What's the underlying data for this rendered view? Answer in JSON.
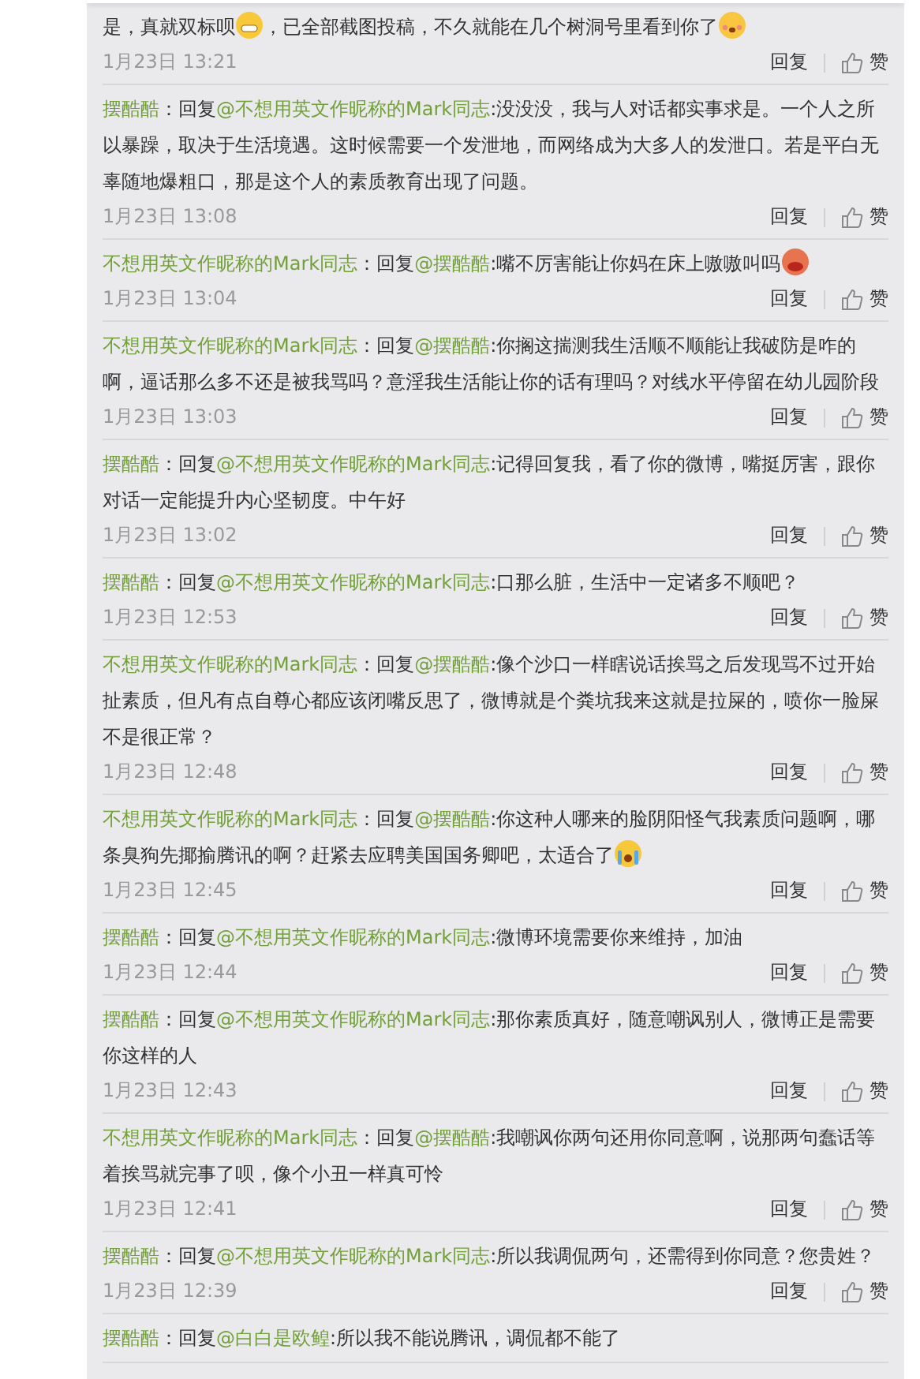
{
  "comments": [
    {
      "parts": [
        {
          "kind": "plain",
          "text": "是，真就双标呗"
        },
        {
          "kind": "grin"
        },
        {
          "kind": "plain",
          "text": "，已全部截图投稿，不久就能在几个树洞号里看到你了"
        },
        {
          "kind": "blush"
        }
      ],
      "time": "1月23日 13:21",
      "reply_label": "回复",
      "like_label": "赞"
    },
    {
      "parts": [
        {
          "kind": "author",
          "text": "摆酷酷"
        },
        {
          "kind": "plain",
          "text": "：回复"
        },
        {
          "kind": "mention",
          "text": "@不想用英文作昵称的Mark同志"
        },
        {
          "kind": "plain",
          "text": ":没没没，我与人对话都实事求是。一个人之所以暴躁，取决于生活境遇。这时候需要一个发泄地，而网络成为大多人的发泄口。若是平白无辜随地爆粗口，那是这个人的素质教育出现了问题。"
        }
      ],
      "time": "1月23日 13:08",
      "reply_label": "回复",
      "like_label": "赞"
    },
    {
      "parts": [
        {
          "kind": "author",
          "text": "不想用英文作昵称的Mark同志"
        },
        {
          "kind": "plain",
          "text": "：回复"
        },
        {
          "kind": "mention",
          "text": "@摆酷酷"
        },
        {
          "kind": "plain",
          "text": ":嘴不厉害能让你妈在床上嗷嗷叫吗"
        },
        {
          "kind": "red"
        }
      ],
      "time": "1月23日 13:04",
      "reply_label": "回复",
      "like_label": "赞"
    },
    {
      "parts": [
        {
          "kind": "author",
          "text": "不想用英文作昵称的Mark同志"
        },
        {
          "kind": "plain",
          "text": "：回复"
        },
        {
          "kind": "mention",
          "text": "@摆酷酷"
        },
        {
          "kind": "plain",
          "text": ":你搁这揣测我生活顺不顺能让我破防是咋的啊，逼话那么多不还是被我骂吗？意淫我生活能让你的话有理吗？对线水平停留在幼儿园阶段"
        }
      ],
      "time": "1月23日 13:03",
      "reply_label": "回复",
      "like_label": "赞"
    },
    {
      "parts": [
        {
          "kind": "author",
          "text": "摆酷酷"
        },
        {
          "kind": "plain",
          "text": "：回复"
        },
        {
          "kind": "mention",
          "text": "@不想用英文作昵称的Mark同志"
        },
        {
          "kind": "plain",
          "text": ":记得回复我，看了你的微博，嘴挺厉害，跟你对话一定能提升内心坚韧度。中午好"
        }
      ],
      "time": "1月23日 13:02",
      "reply_label": "回复",
      "like_label": "赞"
    },
    {
      "parts": [
        {
          "kind": "author",
          "text": "摆酷酷"
        },
        {
          "kind": "plain",
          "text": "：回复"
        },
        {
          "kind": "mention",
          "text": "@不想用英文作昵称的Mark同志"
        },
        {
          "kind": "plain",
          "text": ":口那么脏，生活中一定诸多不顺吧？"
        }
      ],
      "time": "1月23日 12:53",
      "reply_label": "回复",
      "like_label": "赞"
    },
    {
      "parts": [
        {
          "kind": "author",
          "text": "不想用英文作昵称的Mark同志"
        },
        {
          "kind": "plain",
          "text": "：回复"
        },
        {
          "kind": "mention",
          "text": "@摆酷酷"
        },
        {
          "kind": "plain",
          "text": ":像个沙口一样瞎说话挨骂之后发现骂不过开始扯素质，但凡有点自尊心都应该闭嘴反思了，微博就是个粪坑我来这就是拉屎的，喷你一脸屎不是很正常？"
        }
      ],
      "time": "1月23日 12:48",
      "reply_label": "回复",
      "like_label": "赞"
    },
    {
      "parts": [
        {
          "kind": "author",
          "text": "不想用英文作昵称的Mark同志"
        },
        {
          "kind": "plain",
          "text": "：回复"
        },
        {
          "kind": "mention",
          "text": "@摆酷酷"
        },
        {
          "kind": "plain",
          "text": ":你这种人哪来的脸阴阳怪气我素质问题啊，哪条臭狗先揶揄腾讯的啊？赶紧去应聘美国国务卿吧，太适合了"
        },
        {
          "kind": "cry"
        }
      ],
      "time": "1月23日 12:45",
      "reply_label": "回复",
      "like_label": "赞"
    },
    {
      "parts": [
        {
          "kind": "author",
          "text": "摆酷酷"
        },
        {
          "kind": "plain",
          "text": "：回复"
        },
        {
          "kind": "mention",
          "text": "@不想用英文作昵称的Mark同志"
        },
        {
          "kind": "plain",
          "text": ":微博环境需要你来维持，加油"
        }
      ],
      "time": "1月23日 12:44",
      "reply_label": "回复",
      "like_label": "赞"
    },
    {
      "parts": [
        {
          "kind": "author",
          "text": "摆酷酷"
        },
        {
          "kind": "plain",
          "text": "：回复"
        },
        {
          "kind": "mention",
          "text": "@不想用英文作昵称的Mark同志"
        },
        {
          "kind": "plain",
          "text": ":那你素质真好，随意嘲讽别人，微博正是需要你这样的人"
        }
      ],
      "time": "1月23日 12:43",
      "reply_label": "回复",
      "like_label": "赞"
    },
    {
      "parts": [
        {
          "kind": "author",
          "text": "不想用英文作昵称的Mark同志"
        },
        {
          "kind": "plain",
          "text": "：回复"
        },
        {
          "kind": "mention",
          "text": "@摆酷酷"
        },
        {
          "kind": "plain",
          "text": ":我嘲讽你两句还用你同意啊，说那两句蠢话等着挨骂就完事了呗，像个小丑一样真可怜"
        }
      ],
      "time": "1月23日 12:41",
      "reply_label": "回复",
      "like_label": "赞"
    },
    {
      "parts": [
        {
          "kind": "author",
          "text": "摆酷酷"
        },
        {
          "kind": "plain",
          "text": "：回复"
        },
        {
          "kind": "mention",
          "text": "@不想用英文作昵称的Mark同志"
        },
        {
          "kind": "plain",
          "text": ":所以我调侃两句，还需得到你同意？您贵姓？"
        }
      ],
      "time": "1月23日 12:39",
      "reply_label": "回复",
      "like_label": "赞"
    },
    {
      "parts": [
        {
          "kind": "author",
          "text": "摆酷酷"
        },
        {
          "kind": "plain",
          "text": "：回复"
        },
        {
          "kind": "mention",
          "text": "@白白是欧鳇"
        },
        {
          "kind": "plain",
          "text": ":所以我不能说腾讯，调侃都不能了"
        }
      ]
    }
  ]
}
